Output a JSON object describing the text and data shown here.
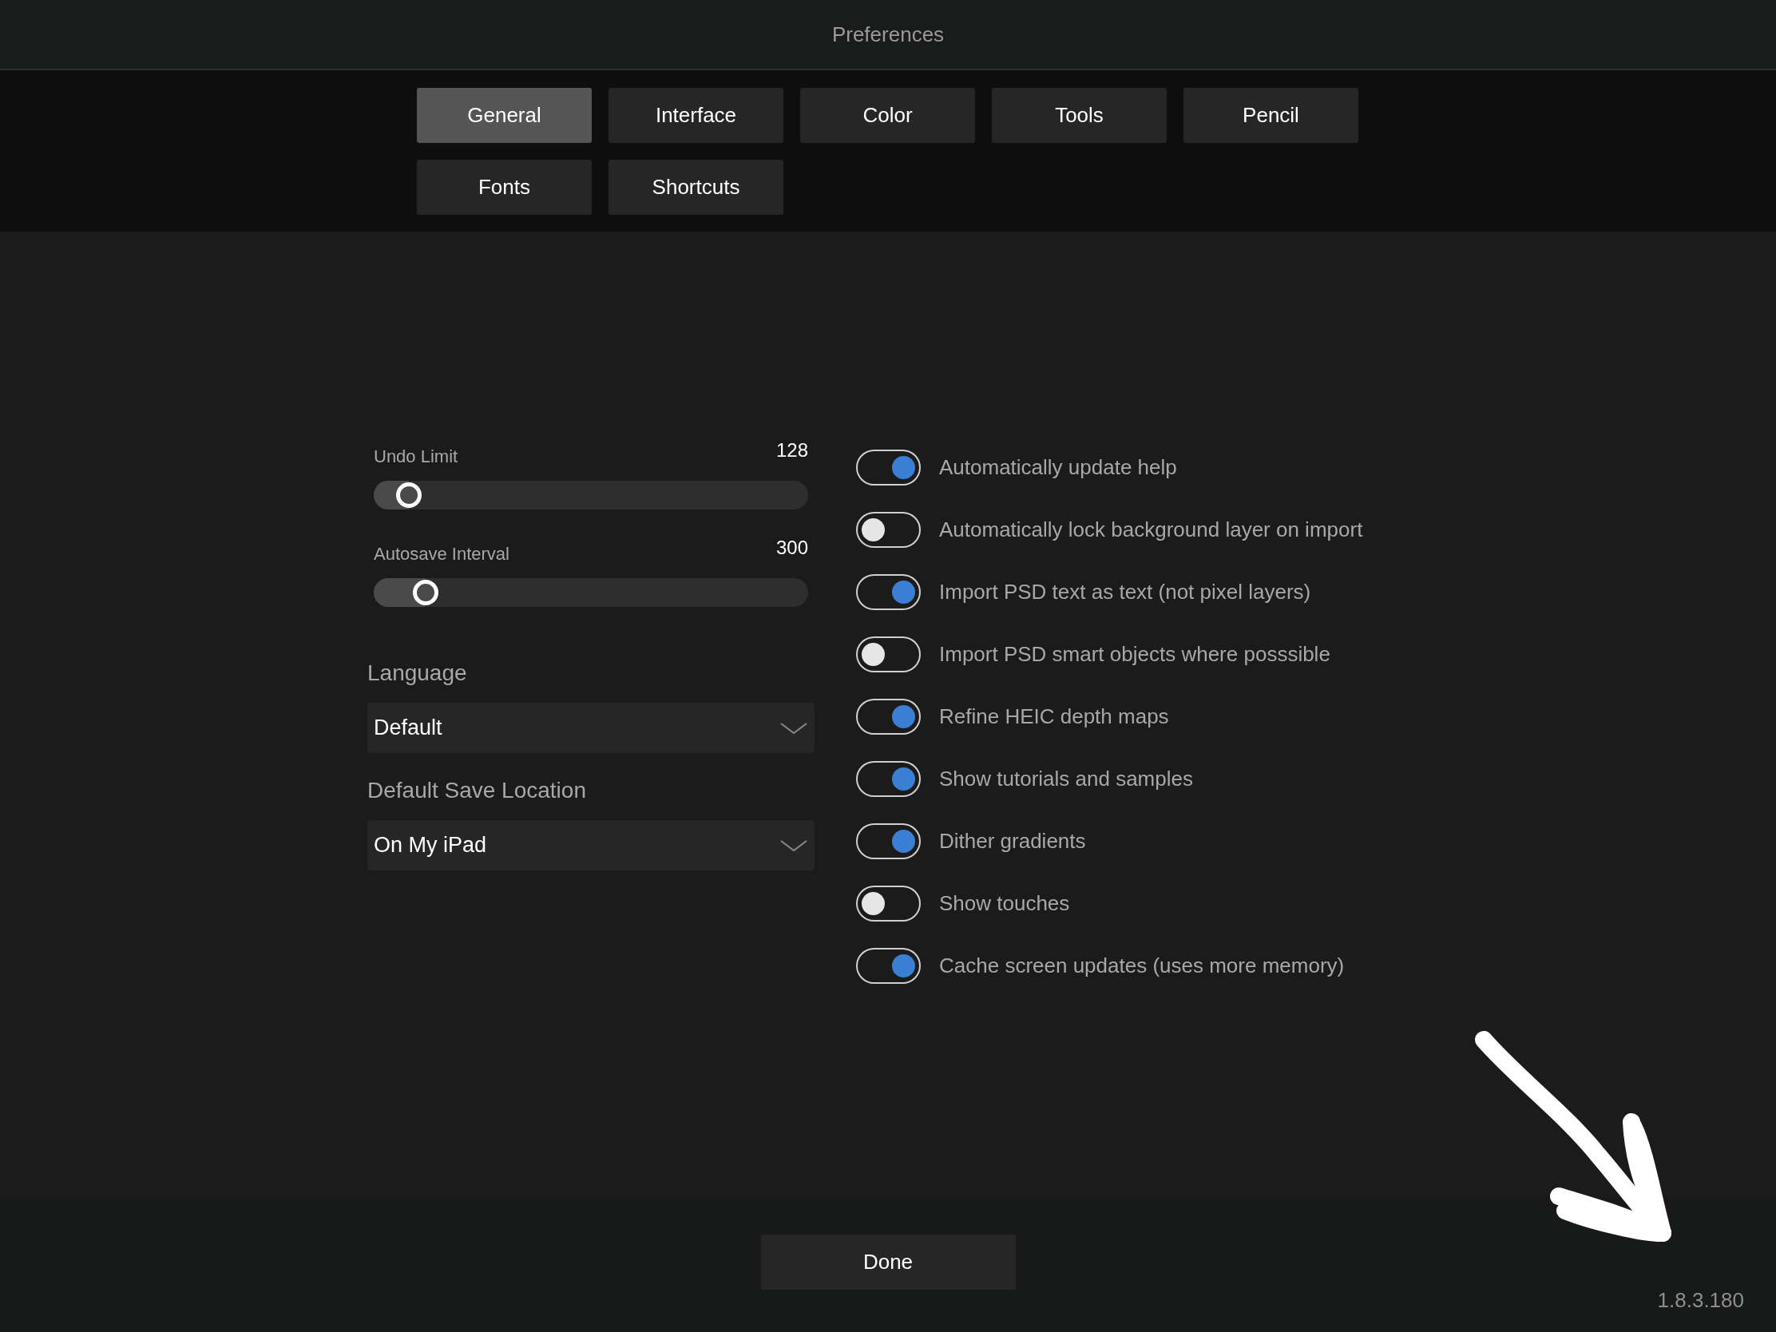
{
  "window": {
    "title": "Preferences"
  },
  "tabs": [
    {
      "label": "General",
      "selected": true
    },
    {
      "label": "Interface",
      "selected": false
    },
    {
      "label": "Color",
      "selected": false
    },
    {
      "label": "Tools",
      "selected": false
    },
    {
      "label": "Pencil",
      "selected": false
    },
    {
      "label": "Fonts",
      "selected": false
    },
    {
      "label": "Shortcuts",
      "selected": false
    }
  ],
  "sliders": [
    {
      "label": "Undo Limit",
      "value": "128",
      "level": 0.08
    },
    {
      "label": "Autosave Interval",
      "value": "300",
      "level": 0.12
    }
  ],
  "dropdowns": [
    {
      "label": "Language",
      "value": "Default"
    },
    {
      "label": "Default Save Location",
      "value": "On My iPad"
    }
  ],
  "toggles": [
    {
      "label": "Automatically update help",
      "on": true
    },
    {
      "label": "Automatically lock background layer on import",
      "on": false
    },
    {
      "label": "Import PSD text as text (not pixel layers)",
      "on": true
    },
    {
      "label": "Import PSD smart objects where posssible",
      "on": false
    },
    {
      "label": "Refine HEIC depth maps",
      "on": true
    },
    {
      "label": "Show tutorials and samples",
      "on": true
    },
    {
      "label": "Dither gradients",
      "on": true
    },
    {
      "label": "Show touches",
      "on": false
    },
    {
      "label": "Cache screen updates (uses more memory)",
      "on": true
    }
  ],
  "footer": {
    "button": "Done",
    "version": "1.8.3.180"
  }
}
